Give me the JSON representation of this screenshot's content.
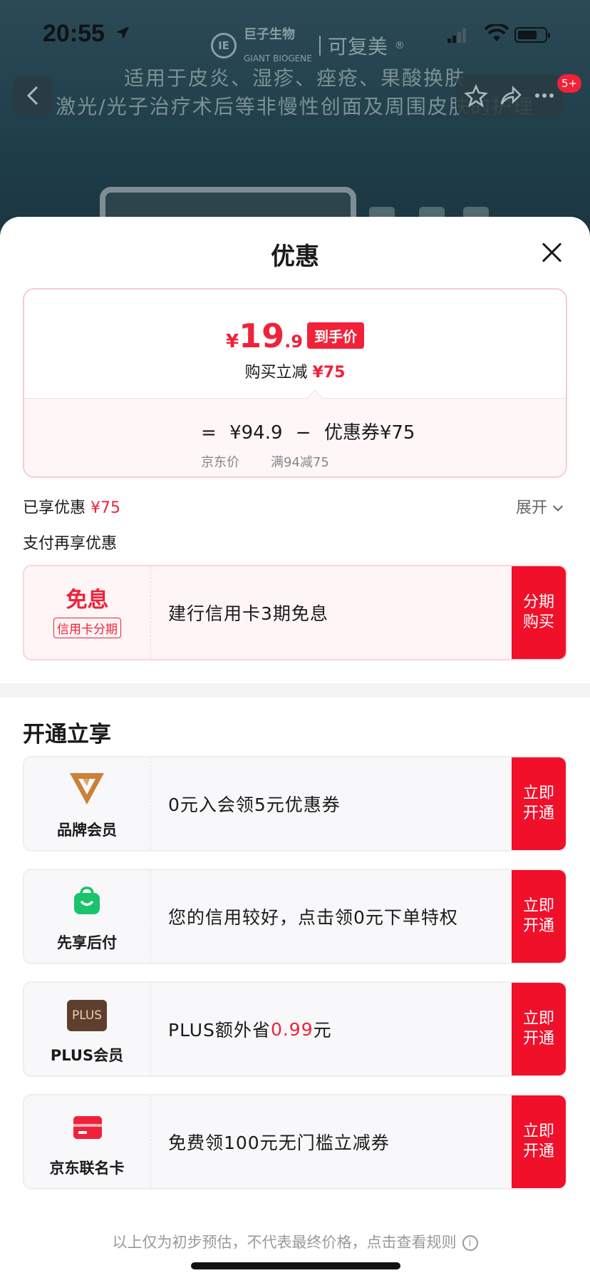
{
  "status_bar": {
    "time": "20:55"
  },
  "background_page": {
    "brand_cn": "巨子生物",
    "brand_en": "GIANT BIOGENE",
    "brand_product": "可复美",
    "brand_mark": "®",
    "line1": "适用于皮炎、湿疹、痤疮、果酸换肤",
    "line2": "激光/光子治疗术后等非慢性创面及周围皮肤的护理",
    "cart_badge": "5+"
  },
  "sheet": {
    "title": "优惠",
    "price": {
      "currency": "¥",
      "integer": "19",
      "decimal": ".9",
      "tag": "到手价",
      "reduce_label": "购买立减",
      "reduce_value": "¥75",
      "eq": "=",
      "jd_price": "¥94.9",
      "jd_price_label": "京东价",
      "minus": "−",
      "coupon": "优惠券¥75",
      "coupon_rule": "满94减75"
    },
    "enjoyed_label": "已享优惠",
    "enjoyed_value": "¥75",
    "expand_label": "展开",
    "pay_more_label": "支付再享优惠",
    "installment": {
      "title": "免息",
      "sub": "信用卡分期",
      "desc": "建行信用卡3期免息",
      "action_line1": "分期",
      "action_line2": "购买"
    },
    "open_section_title": "开通立享",
    "offers": [
      {
        "label": "品牌会员",
        "desc": "0元入会领5元优惠券",
        "action1": "立即",
        "action2": "开通"
      },
      {
        "label": "先享后付",
        "desc": "您的信用较好，点击领0元下单特权",
        "action1": "立即",
        "action2": "开通"
      },
      {
        "label": "PLUS会员",
        "icon_text": "PLUS",
        "desc_prefix": "PLUS额外省",
        "desc_value": "0.99",
        "desc_suffix": "元",
        "action1": "立即",
        "action2": "开通"
      },
      {
        "label": "京东联名卡",
        "desc": "免费领100元无门槛立减券",
        "action1": "立即",
        "action2": "开通"
      }
    ],
    "footer": "以上仅为初步预估，不代表最终价格，点击查看规则",
    "footer_icon": "i"
  },
  "colors": {
    "accent": "#f0223a",
    "brand_gold": "#c9823a",
    "pay_green": "#19c46a",
    "plus_brown": "#5e3f2e"
  }
}
